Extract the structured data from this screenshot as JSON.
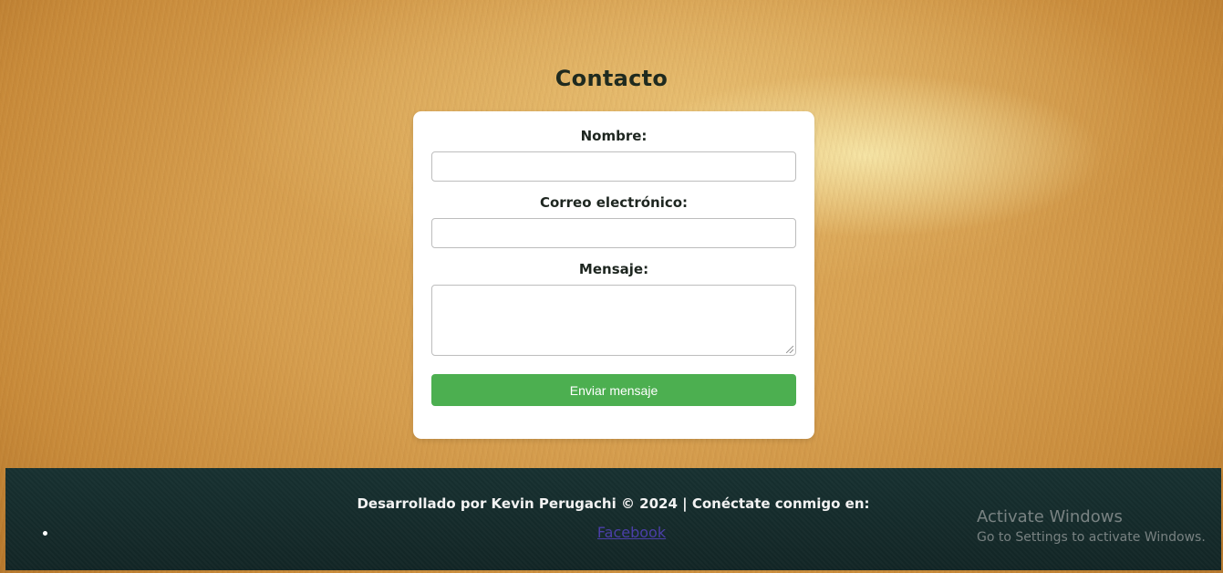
{
  "page": {
    "title": "Contacto"
  },
  "form": {
    "name_label": "Nombre:",
    "name_value": "",
    "email_label": "Correo electrónico:",
    "email_value": "",
    "message_label": "Mensaje:",
    "message_value": "",
    "submit_label": "Enviar mensaje"
  },
  "footer": {
    "credit_text": "Desarrollado por Kevin Perugachi © 2024 | Conéctate conmigo en:",
    "links": [
      {
        "label": "Facebook"
      }
    ]
  },
  "os_watermark": {
    "title": "Activate Windows",
    "subtitle": "Go to Settings to activate Windows."
  },
  "colors": {
    "accent_button": "#4caf50",
    "footer_bg": "#173030",
    "link": "#4b3fa8"
  }
}
